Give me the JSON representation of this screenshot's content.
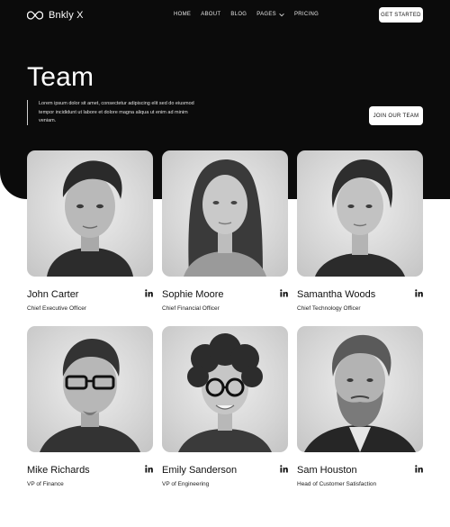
{
  "brand": {
    "name": "Bnkly X"
  },
  "nav": {
    "links": [
      "HOME",
      "ABOUT",
      "BLOG",
      "PAGES",
      "PRICING"
    ],
    "cta": "GET STARTED"
  },
  "hero": {
    "title": "Team",
    "description": "Lorem ipsum dolor sit amet, consectetur adipiscing elit sed do eiusmod tempor incididunt ut labore et dolore magna aliqua ut enim ad minim veniam.",
    "cta": "JOIN OUR TEAM"
  },
  "team": [
    {
      "name": "John Carter",
      "role": "Chief Executive Officer"
    },
    {
      "name": "Sophie Moore",
      "role": "Chief Financial Officer"
    },
    {
      "name": "Samantha Woods",
      "role": "Chief Technology Officer"
    },
    {
      "name": "Mike Richards",
      "role": "VP of Finance"
    },
    {
      "name": "Emily Sanderson",
      "role": "VP of Engineering"
    },
    {
      "name": "Sam Houston",
      "role": "Head of Customer Satisfaction"
    }
  ],
  "icons": {
    "social": "linkedin-icon",
    "dropdown": "chevron-down-icon"
  },
  "colors": {
    "hero_bg": "#0b0b0b",
    "page_bg": "#ffffff",
    "text": "#111111"
  }
}
